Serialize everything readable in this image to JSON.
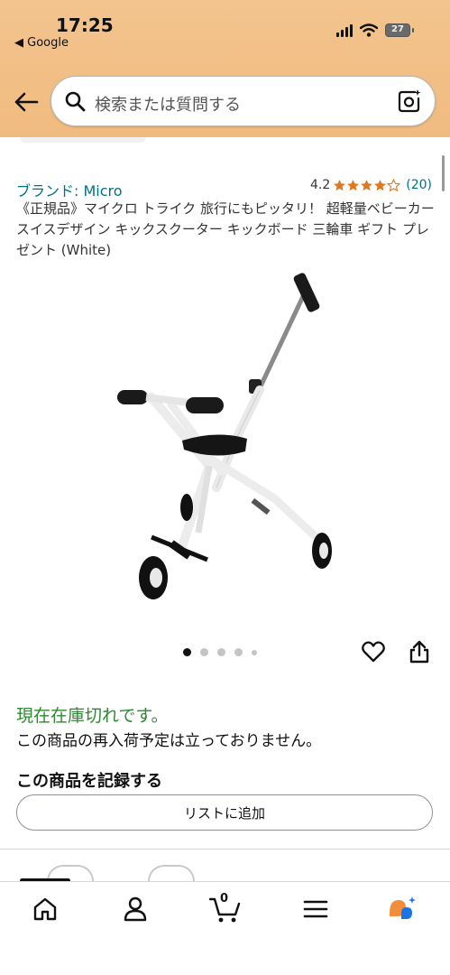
{
  "status_bar": {
    "time": "17:25",
    "back_app": "◀ Google",
    "battery": "27"
  },
  "header": {
    "search_placeholder": "検索または質問する",
    "icons": [
      "back-arrow-icon",
      "search-icon",
      "camera-icon"
    ]
  },
  "product": {
    "brand": "ブランド: Micro",
    "rating_value": "4.2",
    "rating_stars": 4.2,
    "review_count": "(20)",
    "title": "《正規品》マイクロ トライク 旅行にもピッタリ！ 超軽量ベビーカー スイスデザイン キックスクーター キックボード 三輪車 ギフト プレゼント (White)",
    "image_count": 5,
    "active_image": 1
  },
  "availability": {
    "status": "現在在庫切れです。",
    "note": "この商品の再入荷予定は立っておりません。"
  },
  "record": {
    "heading": "この商品を記録する",
    "add_to_list": "リストに追加"
  },
  "bottom_nav": {
    "cart_count": "0",
    "items": [
      "home-icon",
      "account-icon",
      "cart-icon",
      "menu-icon",
      "rufus-icon"
    ]
  },
  "colors": {
    "header_bg": "#f0bb80",
    "link": "#007185",
    "in_stock_status": "#2c8a31",
    "star": "#de7921",
    "assistant_orange": "#f28d3c",
    "assistant_blue": "#1a73e8"
  }
}
